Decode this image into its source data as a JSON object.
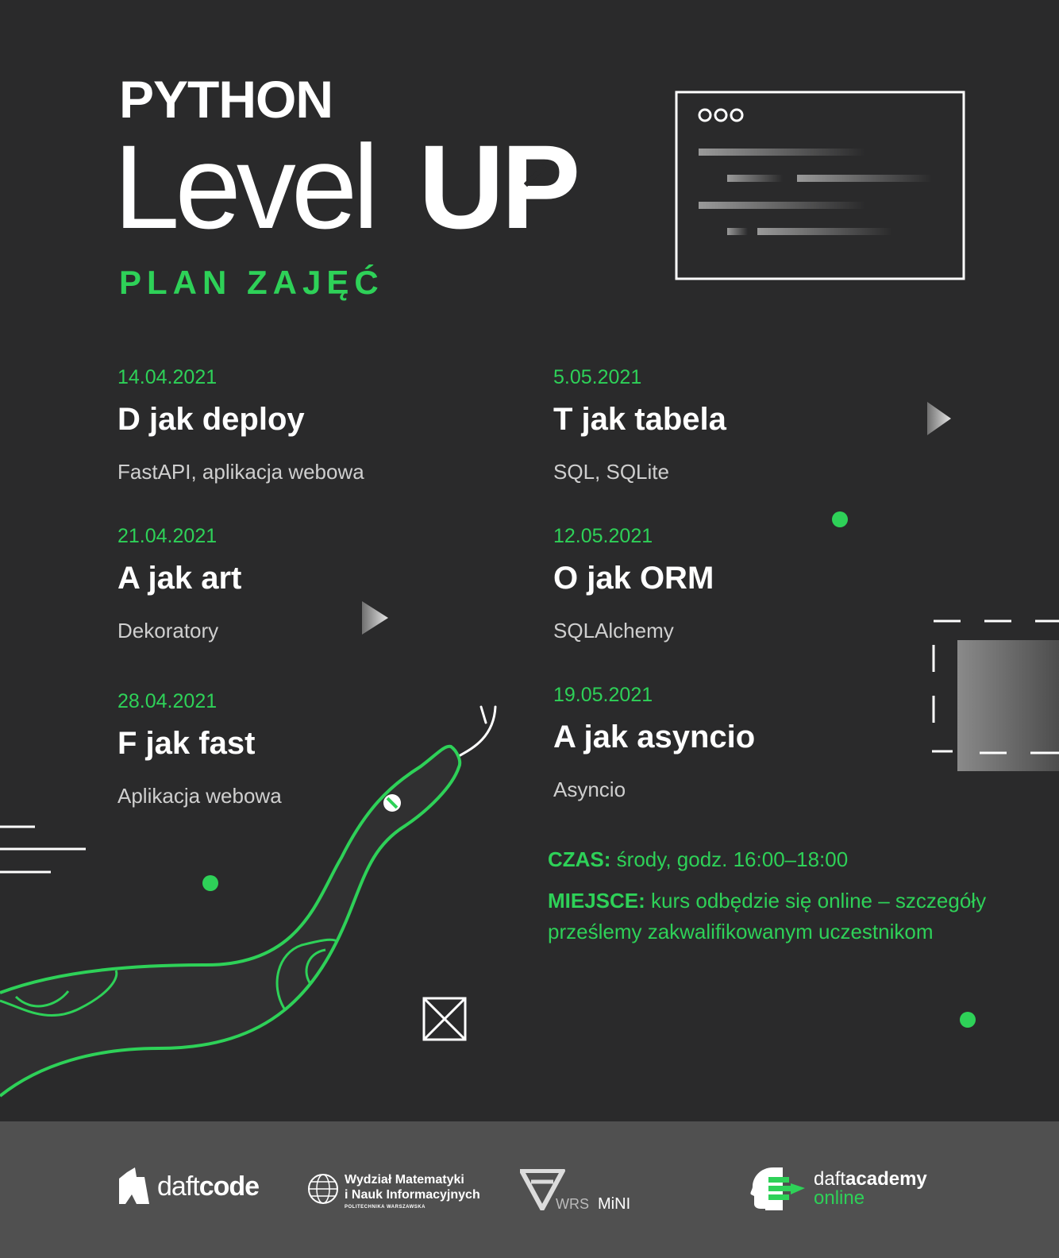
{
  "header": {
    "kicker": "PYTHON",
    "title_light": "Level",
    "title_bold": "UP",
    "subtitle": "PLAN ZAJĘĆ"
  },
  "schedule": [
    {
      "date": "14.04.2021",
      "title": "D jak deploy",
      "topic": "FastAPI, aplikacja webowa"
    },
    {
      "date": "21.04.2021",
      "title": "A jak art",
      "topic": "Dekoratory"
    },
    {
      "date": "28.04.2021",
      "title": "F jak fast",
      "topic": "Aplikacja webowa"
    },
    {
      "date": "5.05.2021",
      "title": "T jak tabela",
      "topic": "SQL, SQLite"
    },
    {
      "date": "12.05.2021",
      "title": "O jak ORM",
      "topic": "SQLAlchemy"
    },
    {
      "date": "19.05.2021",
      "title": "A jak asyncio",
      "topic": "Asyncio"
    }
  ],
  "info": {
    "time_label": "CZAS:",
    "time_value": "środy, godz. 16:00–18:00",
    "place_label": "MIEJSCE:",
    "place_value": "kurs odbędzie się online – szczegóły prześlemy zakwalifikowanym uczestnikom"
  },
  "footer": {
    "logo1_light": "daft",
    "logo1_bold": "code",
    "logo2_line1": "Wydział Matematyki",
    "logo2_line2": "i Nauk Informacyjnych",
    "logo2_line3": "POLITECHNIKA WARSZAWSKA",
    "logo3_a": "WRS",
    "logo3_b": "MiNI",
    "logo4_light": "daft",
    "logo4_bold": "academy",
    "logo4_sub": "online"
  },
  "colors": {
    "accent": "#2ed158",
    "background": "#2a2a2b",
    "footer": "#505050"
  }
}
